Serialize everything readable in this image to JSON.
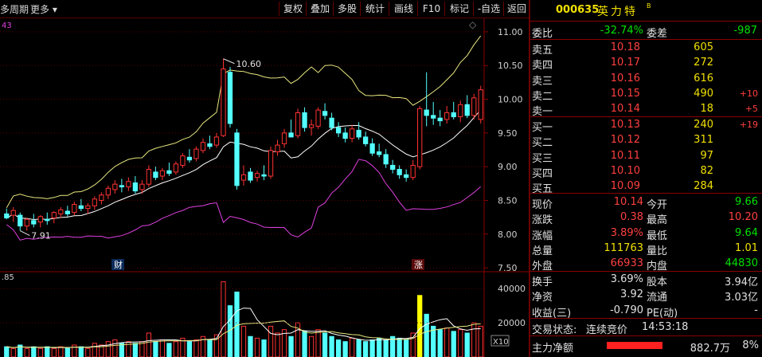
{
  "toolbar": {
    "period_label": "多周期",
    "more_label": "更多",
    "buttons": [
      "复权",
      "叠加",
      "多股",
      "统计",
      "画线",
      "F10",
      "标记",
      "-自选",
      "返回"
    ]
  },
  "chart": {
    "indicator_label": "43",
    "y_ticks": [
      "11.00",
      "10.50",
      "10.00",
      "9.50",
      "9.00",
      "8.50",
      "8.00",
      "7.50"
    ],
    "high_annotation": "10.60",
    "low_annotation": "7.91",
    "marker_cai": "财",
    "marker_zhang": "涨",
    "volume_label": ".85",
    "vol_ticks": [
      "40000",
      "20000"
    ],
    "vol_unit": "X10",
    "colors": {
      "up": "#ff3232",
      "up_fill": "#54ffff",
      "down": "#54ffff",
      "ma_upper": "#e8e880",
      "ma_mid": "#ffffff",
      "ma_lower": "#e040e0",
      "volume_highlight": "#ffff00"
    }
  },
  "chart_data": {
    "type": "candlestick",
    "ylim": [
      7.3,
      11.2
    ],
    "candles": [
      {
        "o": 8.3,
        "h": 8.38,
        "l": 8.22,
        "c": 8.24
      },
      {
        "o": 8.28,
        "h": 8.4,
        "l": 8.18,
        "c": 8.35
      },
      {
        "o": 8.28,
        "h": 8.32,
        "l": 8.05,
        "c": 8.12
      },
      {
        "o": 8.12,
        "h": 8.24,
        "l": 8.05,
        "c": 8.22
      },
      {
        "o": 8.2,
        "h": 8.3,
        "l": 8.1,
        "c": 8.15
      },
      {
        "o": 8.18,
        "h": 8.28,
        "l": 8.1,
        "c": 8.26
      },
      {
        "o": 8.22,
        "h": 8.32,
        "l": 8.14,
        "c": 8.2
      },
      {
        "o": 8.24,
        "h": 8.34,
        "l": 8.16,
        "c": 8.32
      },
      {
        "o": 8.3,
        "h": 8.4,
        "l": 8.24,
        "c": 8.36
      },
      {
        "o": 8.34,
        "h": 8.42,
        "l": 8.26,
        "c": 8.3
      },
      {
        "o": 8.32,
        "h": 8.48,
        "l": 8.28,
        "c": 8.44
      },
      {
        "o": 8.42,
        "h": 8.52,
        "l": 8.34,
        "c": 8.38
      },
      {
        "o": 8.38,
        "h": 8.46,
        "l": 8.3,
        "c": 8.42
      },
      {
        "o": 8.42,
        "h": 8.56,
        "l": 8.36,
        "c": 8.52
      },
      {
        "o": 8.5,
        "h": 8.62,
        "l": 8.44,
        "c": 8.58
      },
      {
        "o": 8.58,
        "h": 8.72,
        "l": 8.52,
        "c": 8.68
      },
      {
        "o": 8.66,
        "h": 8.8,
        "l": 8.6,
        "c": 8.74
      },
      {
        "o": 8.72,
        "h": 8.82,
        "l": 8.62,
        "c": 8.7
      },
      {
        "o": 8.7,
        "h": 8.84,
        "l": 8.64,
        "c": 8.78
      },
      {
        "o": 8.76,
        "h": 8.86,
        "l": 8.6,
        "c": 8.64
      },
      {
        "o": 8.66,
        "h": 8.8,
        "l": 8.6,
        "c": 8.74
      },
      {
        "o": 8.74,
        "h": 9.02,
        "l": 8.7,
        "c": 8.96
      },
      {
        "o": 8.92,
        "h": 9.0,
        "l": 8.8,
        "c": 8.84
      },
      {
        "o": 8.86,
        "h": 8.98,
        "l": 8.8,
        "c": 8.94
      },
      {
        "o": 8.94,
        "h": 9.06,
        "l": 8.86,
        "c": 8.9
      },
      {
        "o": 8.92,
        "h": 9.08,
        "l": 8.88,
        "c": 9.04
      },
      {
        "o": 9.02,
        "h": 9.2,
        "l": 8.98,
        "c": 9.16
      },
      {
        "o": 9.14,
        "h": 9.26,
        "l": 9.06,
        "c": 9.1
      },
      {
        "o": 9.12,
        "h": 9.3,
        "l": 9.08,
        "c": 9.26
      },
      {
        "o": 9.24,
        "h": 9.42,
        "l": 9.2,
        "c": 9.36
      },
      {
        "o": 9.34,
        "h": 9.46,
        "l": 9.26,
        "c": 9.3
      },
      {
        "o": 9.32,
        "h": 9.5,
        "l": 9.28,
        "c": 9.44
      },
      {
        "o": 9.46,
        "h": 10.6,
        "l": 9.44,
        "c": 10.45
      },
      {
        "o": 10.4,
        "h": 10.48,
        "l": 9.58,
        "c": 9.64
      },
      {
        "o": 9.5,
        "h": 9.56,
        "l": 8.66,
        "c": 8.72
      },
      {
        "o": 8.8,
        "h": 9.02,
        "l": 8.72,
        "c": 8.88
      },
      {
        "o": 8.92,
        "h": 8.98,
        "l": 8.76,
        "c": 8.8
      },
      {
        "o": 8.84,
        "h": 8.94,
        "l": 8.78,
        "c": 8.9
      },
      {
        "o": 8.88,
        "h": 9.02,
        "l": 8.8,
        "c": 8.86
      },
      {
        "o": 8.86,
        "h": 9.3,
        "l": 8.82,
        "c": 9.24
      },
      {
        "o": 9.22,
        "h": 9.4,
        "l": 9.16,
        "c": 9.32
      },
      {
        "o": 9.34,
        "h": 9.56,
        "l": 9.28,
        "c": 9.5
      },
      {
        "o": 9.5,
        "h": 9.7,
        "l": 9.44,
        "c": 9.44
      },
      {
        "o": 9.46,
        "h": 9.86,
        "l": 9.42,
        "c": 9.8
      },
      {
        "o": 9.8,
        "h": 9.88,
        "l": 9.52,
        "c": 9.58
      },
      {
        "o": 9.58,
        "h": 9.7,
        "l": 9.46,
        "c": 9.62
      },
      {
        "o": 9.6,
        "h": 9.88,
        "l": 9.56,
        "c": 9.84
      },
      {
        "o": 9.82,
        "h": 9.94,
        "l": 9.7,
        "c": 9.76
      },
      {
        "o": 9.72,
        "h": 9.8,
        "l": 9.54,
        "c": 9.58
      },
      {
        "o": 9.58,
        "h": 9.66,
        "l": 9.44,
        "c": 9.5
      },
      {
        "o": 9.5,
        "h": 9.58,
        "l": 9.36,
        "c": 9.42
      },
      {
        "o": 9.42,
        "h": 9.62,
        "l": 9.36,
        "c": 9.56
      },
      {
        "o": 9.54,
        "h": 9.66,
        "l": 9.4,
        "c": 9.44
      },
      {
        "o": 9.44,
        "h": 9.52,
        "l": 9.3,
        "c": 9.34
      },
      {
        "o": 9.34,
        "h": 9.42,
        "l": 9.16,
        "c": 9.2
      },
      {
        "o": 9.22,
        "h": 9.34,
        "l": 9.14,
        "c": 9.18
      },
      {
        "o": 9.18,
        "h": 9.26,
        "l": 8.98,
        "c": 9.04
      },
      {
        "o": 9.02,
        "h": 9.1,
        "l": 8.9,
        "c": 8.96
      },
      {
        "o": 8.96,
        "h": 9.02,
        "l": 8.82,
        "c": 8.88
      },
      {
        "o": 8.88,
        "h": 8.96,
        "l": 8.78,
        "c": 8.84
      },
      {
        "o": 8.84,
        "h": 9.1,
        "l": 8.8,
        "c": 9.02
      },
      {
        "o": 9.0,
        "h": 9.9,
        "l": 8.96,
        "c": 9.86
      },
      {
        "o": 9.84,
        "h": 10.4,
        "l": 9.6,
        "c": 9.76
      },
      {
        "o": 9.76,
        "h": 9.96,
        "l": 9.62,
        "c": 9.72
      },
      {
        "o": 9.72,
        "h": 9.84,
        "l": 9.6,
        "c": 9.68
      },
      {
        "o": 9.7,
        "h": 9.9,
        "l": 9.64,
        "c": 9.8
      },
      {
        "o": 9.8,
        "h": 9.96,
        "l": 9.7,
        "c": 9.74
      },
      {
        "o": 9.74,
        "h": 9.98,
        "l": 9.66,
        "c": 9.92
      },
      {
        "o": 9.92,
        "h": 10.06,
        "l": 9.72,
        "c": 9.76
      },
      {
        "o": 9.76,
        "h": 10.08,
        "l": 9.7,
        "c": 10.02
      },
      {
        "o": 9.7,
        "h": 10.2,
        "l": 9.64,
        "c": 10.14
      }
    ],
    "volume": [
      6,
      5,
      7,
      5,
      6,
      5,
      6,
      5,
      6,
      5,
      7,
      6,
      5,
      8,
      7,
      9,
      10,
      8,
      9,
      8,
      9,
      14,
      9,
      10,
      8,
      9,
      11,
      9,
      10,
      12,
      10,
      13,
      44,
      30,
      38,
      18,
      12,
      11,
      10,
      18,
      14,
      16,
      12,
      20,
      15,
      12,
      16,
      14,
      12,
      10,
      9,
      11,
      10,
      9,
      10,
      11,
      10,
      12,
      11,
      10,
      14,
      36,
      25,
      18,
      16,
      17,
      15,
      16,
      14,
      20,
      18
    ]
  },
  "quote": {
    "code": "000635",
    "name": "英力特",
    "suffix": "B",
    "weibi_label": "委比",
    "weibi_value": "-32.74%",
    "weicha_label": "委差",
    "weicha_value": "-987",
    "asks": [
      {
        "label": "卖五",
        "price": "10.18",
        "vol": "605",
        "chg": ""
      },
      {
        "label": "卖四",
        "price": "10.17",
        "vol": "272",
        "chg": ""
      },
      {
        "label": "卖三",
        "price": "10.16",
        "vol": "616",
        "chg": ""
      },
      {
        "label": "卖二",
        "price": "10.15",
        "vol": "490",
        "chg": "+10"
      },
      {
        "label": "卖一",
        "price": "10.14",
        "vol": "18",
        "chg": "+5"
      }
    ],
    "bids": [
      {
        "label": "买一",
        "price": "10.13",
        "vol": "240",
        "chg": "+19"
      },
      {
        "label": "买二",
        "price": "10.12",
        "vol": "311",
        "chg": ""
      },
      {
        "label": "买三",
        "price": "10.11",
        "vol": "97",
        "chg": ""
      },
      {
        "label": "买四",
        "price": "10.10",
        "vol": "82",
        "chg": ""
      },
      {
        "label": "买五",
        "price": "10.09",
        "vol": "284",
        "chg": ""
      }
    ],
    "stats": [
      {
        "l1": "现价",
        "v1": "10.14",
        "c1": "r",
        "l2": "今开",
        "v2": "9.66",
        "c2": "g"
      },
      {
        "l1": "涨跌",
        "v1": "0.38",
        "c1": "r",
        "l2": "最高",
        "v2": "10.20",
        "c2": "r"
      },
      {
        "l1": "涨幅",
        "v1": "3.89%",
        "c1": "r",
        "l2": "最低",
        "v2": "9.64",
        "c2": "g"
      },
      {
        "l1": "总量",
        "v1": "111763",
        "c1": "y",
        "l2": "量比",
        "v2": "1.01",
        "c2": "y"
      },
      {
        "l1": "外盘",
        "v1": "66933",
        "c1": "r",
        "l2": "内盘",
        "v2": "44830",
        "c2": "g"
      }
    ],
    "stats2": [
      {
        "l1": "换手",
        "v1": "3.69%",
        "l2": "股本",
        "v2": "3.94亿"
      },
      {
        "l1": "净资",
        "v1": "3.92",
        "l2": "流通",
        "v2": "3.03亿"
      },
      {
        "l1": "收益(三)",
        "v1": "-0.790",
        "l2": "PE(动)",
        "v2": "-"
      }
    ],
    "trade_status_label": "交易状态:",
    "trade_status_value": "连续竞价",
    "trade_time": "14:53:18",
    "main_net_label": "主力净额",
    "main_net_value": "882.7万",
    "main_net_pct": "8%"
  }
}
